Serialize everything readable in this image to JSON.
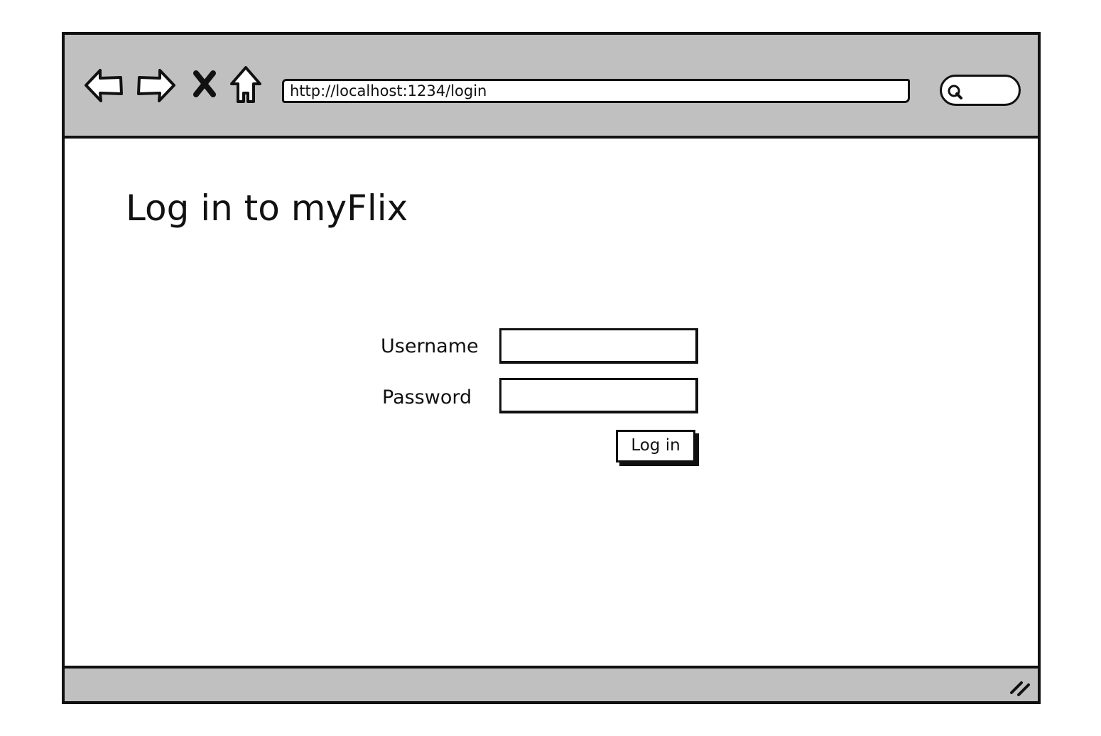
{
  "browser": {
    "url": "http://localhost:1234/login",
    "toolbar_icons": [
      "back-arrow-icon",
      "forward-arrow-icon",
      "close-x-icon",
      "home-icon",
      "search-icon"
    ],
    "toolbar_color": "#c0c0c0"
  },
  "page": {
    "title": "Log in to myFlix"
  },
  "form": {
    "username_label": "Username",
    "username_value": "",
    "password_label": "Password",
    "password_value": "",
    "login_button_label": "Log in"
  },
  "status_bar": {
    "icons": [
      "resize-grip-icon"
    ]
  }
}
